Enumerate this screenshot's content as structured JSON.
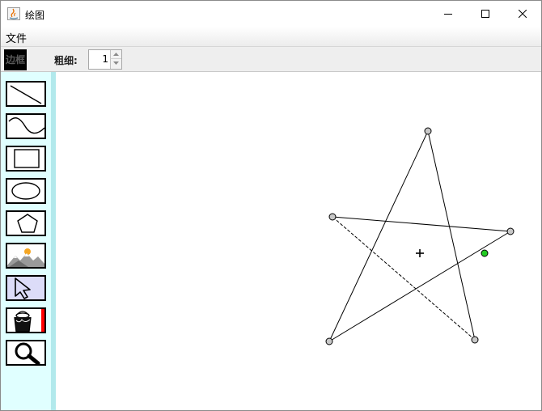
{
  "window": {
    "title": "绘图"
  },
  "menubar": {
    "items": [
      {
        "label": "文件"
      }
    ]
  },
  "toolbar": {
    "border_label": "边框",
    "border_color": "#000000",
    "thickness_label": "粗细:",
    "thickness_value": "1"
  },
  "tools": [
    {
      "name": "line",
      "icon": "line-icon"
    },
    {
      "name": "curve",
      "icon": "curve-icon"
    },
    {
      "name": "rectangle",
      "icon": "rectangle-icon"
    },
    {
      "name": "ellipse",
      "icon": "ellipse-icon"
    },
    {
      "name": "polygon",
      "icon": "pentagon-icon"
    },
    {
      "name": "image",
      "icon": "landscape-image-icon"
    },
    {
      "name": "select",
      "icon": "cursor-arrow-icon",
      "selected": true
    },
    {
      "name": "fill",
      "icon": "paint-bucket-icon",
      "fill_color": "#ff0000"
    },
    {
      "name": "zoom",
      "icon": "magnifier-icon"
    }
  ],
  "colors": {
    "panel_bg": "#e0ffff",
    "panel_divider": "#b2e9ec",
    "selected_tool_bg": "#dcdcf8",
    "handle_fill": "#c8c8c8",
    "active_handle_fill": "#22cc22"
  }
}
